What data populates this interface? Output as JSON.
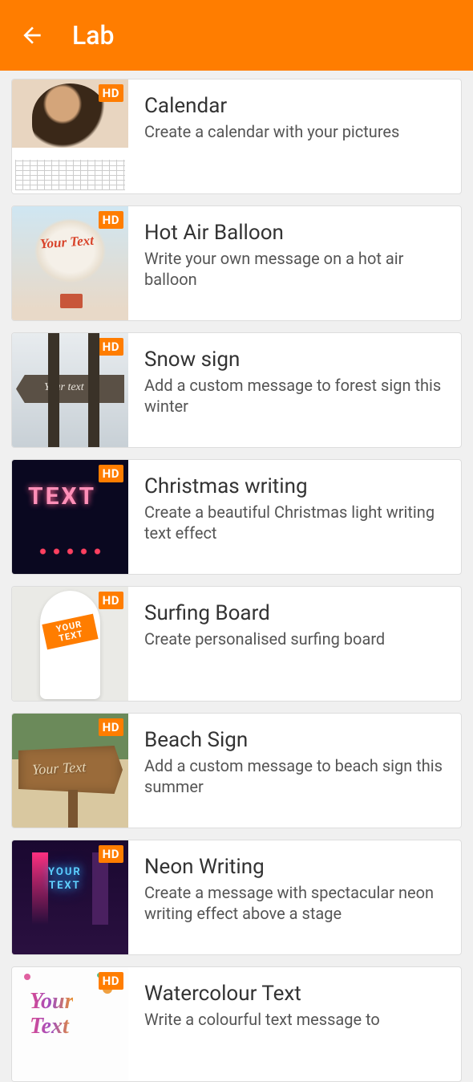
{
  "header": {
    "title": "Lab"
  },
  "hd_label": "HD",
  "items": [
    {
      "title": "Calendar",
      "desc": "Create a calendar with your pictures",
      "thumb_class": "thumb-calendar",
      "overlay": ""
    },
    {
      "title": "Hot Air Balloon",
      "desc": "Write your own message on a hot air balloon",
      "thumb_class": "thumb-balloon",
      "overlay": "Your Text"
    },
    {
      "title": "Snow sign",
      "desc": "Add a custom message to forest sign this winter",
      "thumb_class": "thumb-snow",
      "overlay": "Your text"
    },
    {
      "title": "Christmas writing",
      "desc": "Create a beautiful Christmas light writing text effect",
      "thumb_class": "thumb-christmas",
      "overlay": "TEXT"
    },
    {
      "title": "Surfing Board",
      "desc": "Create personalised surfing board",
      "thumb_class": "thumb-surf",
      "overlay": "YOUR\nTEXT"
    },
    {
      "title": "Beach Sign",
      "desc": "Add a custom message to beach sign this summer",
      "thumb_class": "thumb-beach",
      "overlay": "Your Text"
    },
    {
      "title": "Neon Writing",
      "desc": "Create a message with spectacular neon writing effect above a stage",
      "thumb_class": "thumb-neon",
      "overlay": "YOUR\nTEXT"
    },
    {
      "title": "Watercolour Text",
      "desc": "Write a colourful text message to",
      "thumb_class": "thumb-water",
      "overlay": "Your\nText"
    }
  ]
}
